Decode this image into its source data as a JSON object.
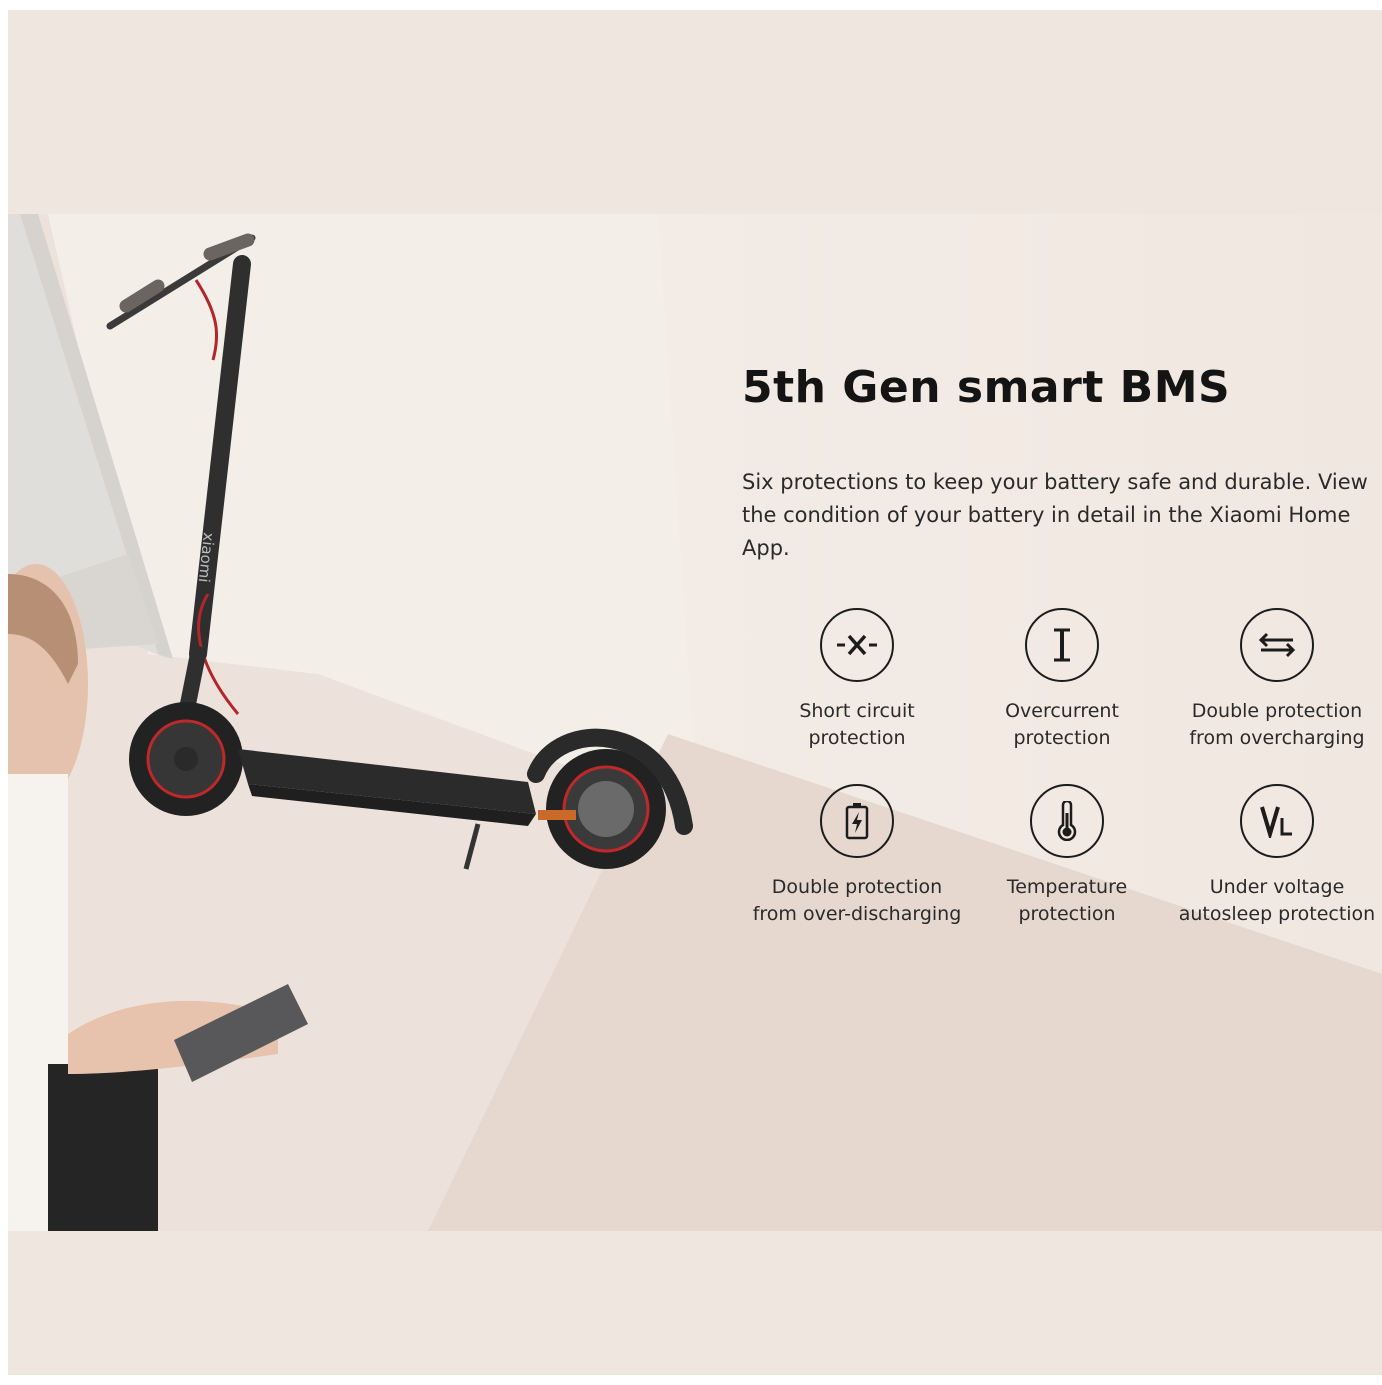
{
  "heading": "5th Gen smart BMS",
  "description": "Six protections to keep your battery safe and durable. View the condition of your battery in detail in the Xiaomi Home App.",
  "scooter_brand_text": "xiaomi",
  "features": [
    {
      "icon": "short-circuit-icon",
      "label_line1": "Short circuit",
      "label_line2": "protection"
    },
    {
      "icon": "overcurrent-icon",
      "label_line1": "Overcurrent",
      "label_line2": "protection"
    },
    {
      "icon": "overcharging-icon",
      "label_line1": "Double protection",
      "label_line2": "from overcharging"
    },
    {
      "icon": "battery-discharge-icon",
      "label_line1": "Double protection",
      "label_line2": "from over-discharging"
    },
    {
      "icon": "thermometer-icon",
      "label_line1": "Temperature",
      "label_line2": "protection"
    },
    {
      "icon": "voltage-icon",
      "label_line1": "Under voltage",
      "label_line2": "autosleep protection"
    }
  ],
  "colors": {
    "background": "#efe6e0",
    "text": "#141414",
    "accent_red": "#c0282a"
  }
}
